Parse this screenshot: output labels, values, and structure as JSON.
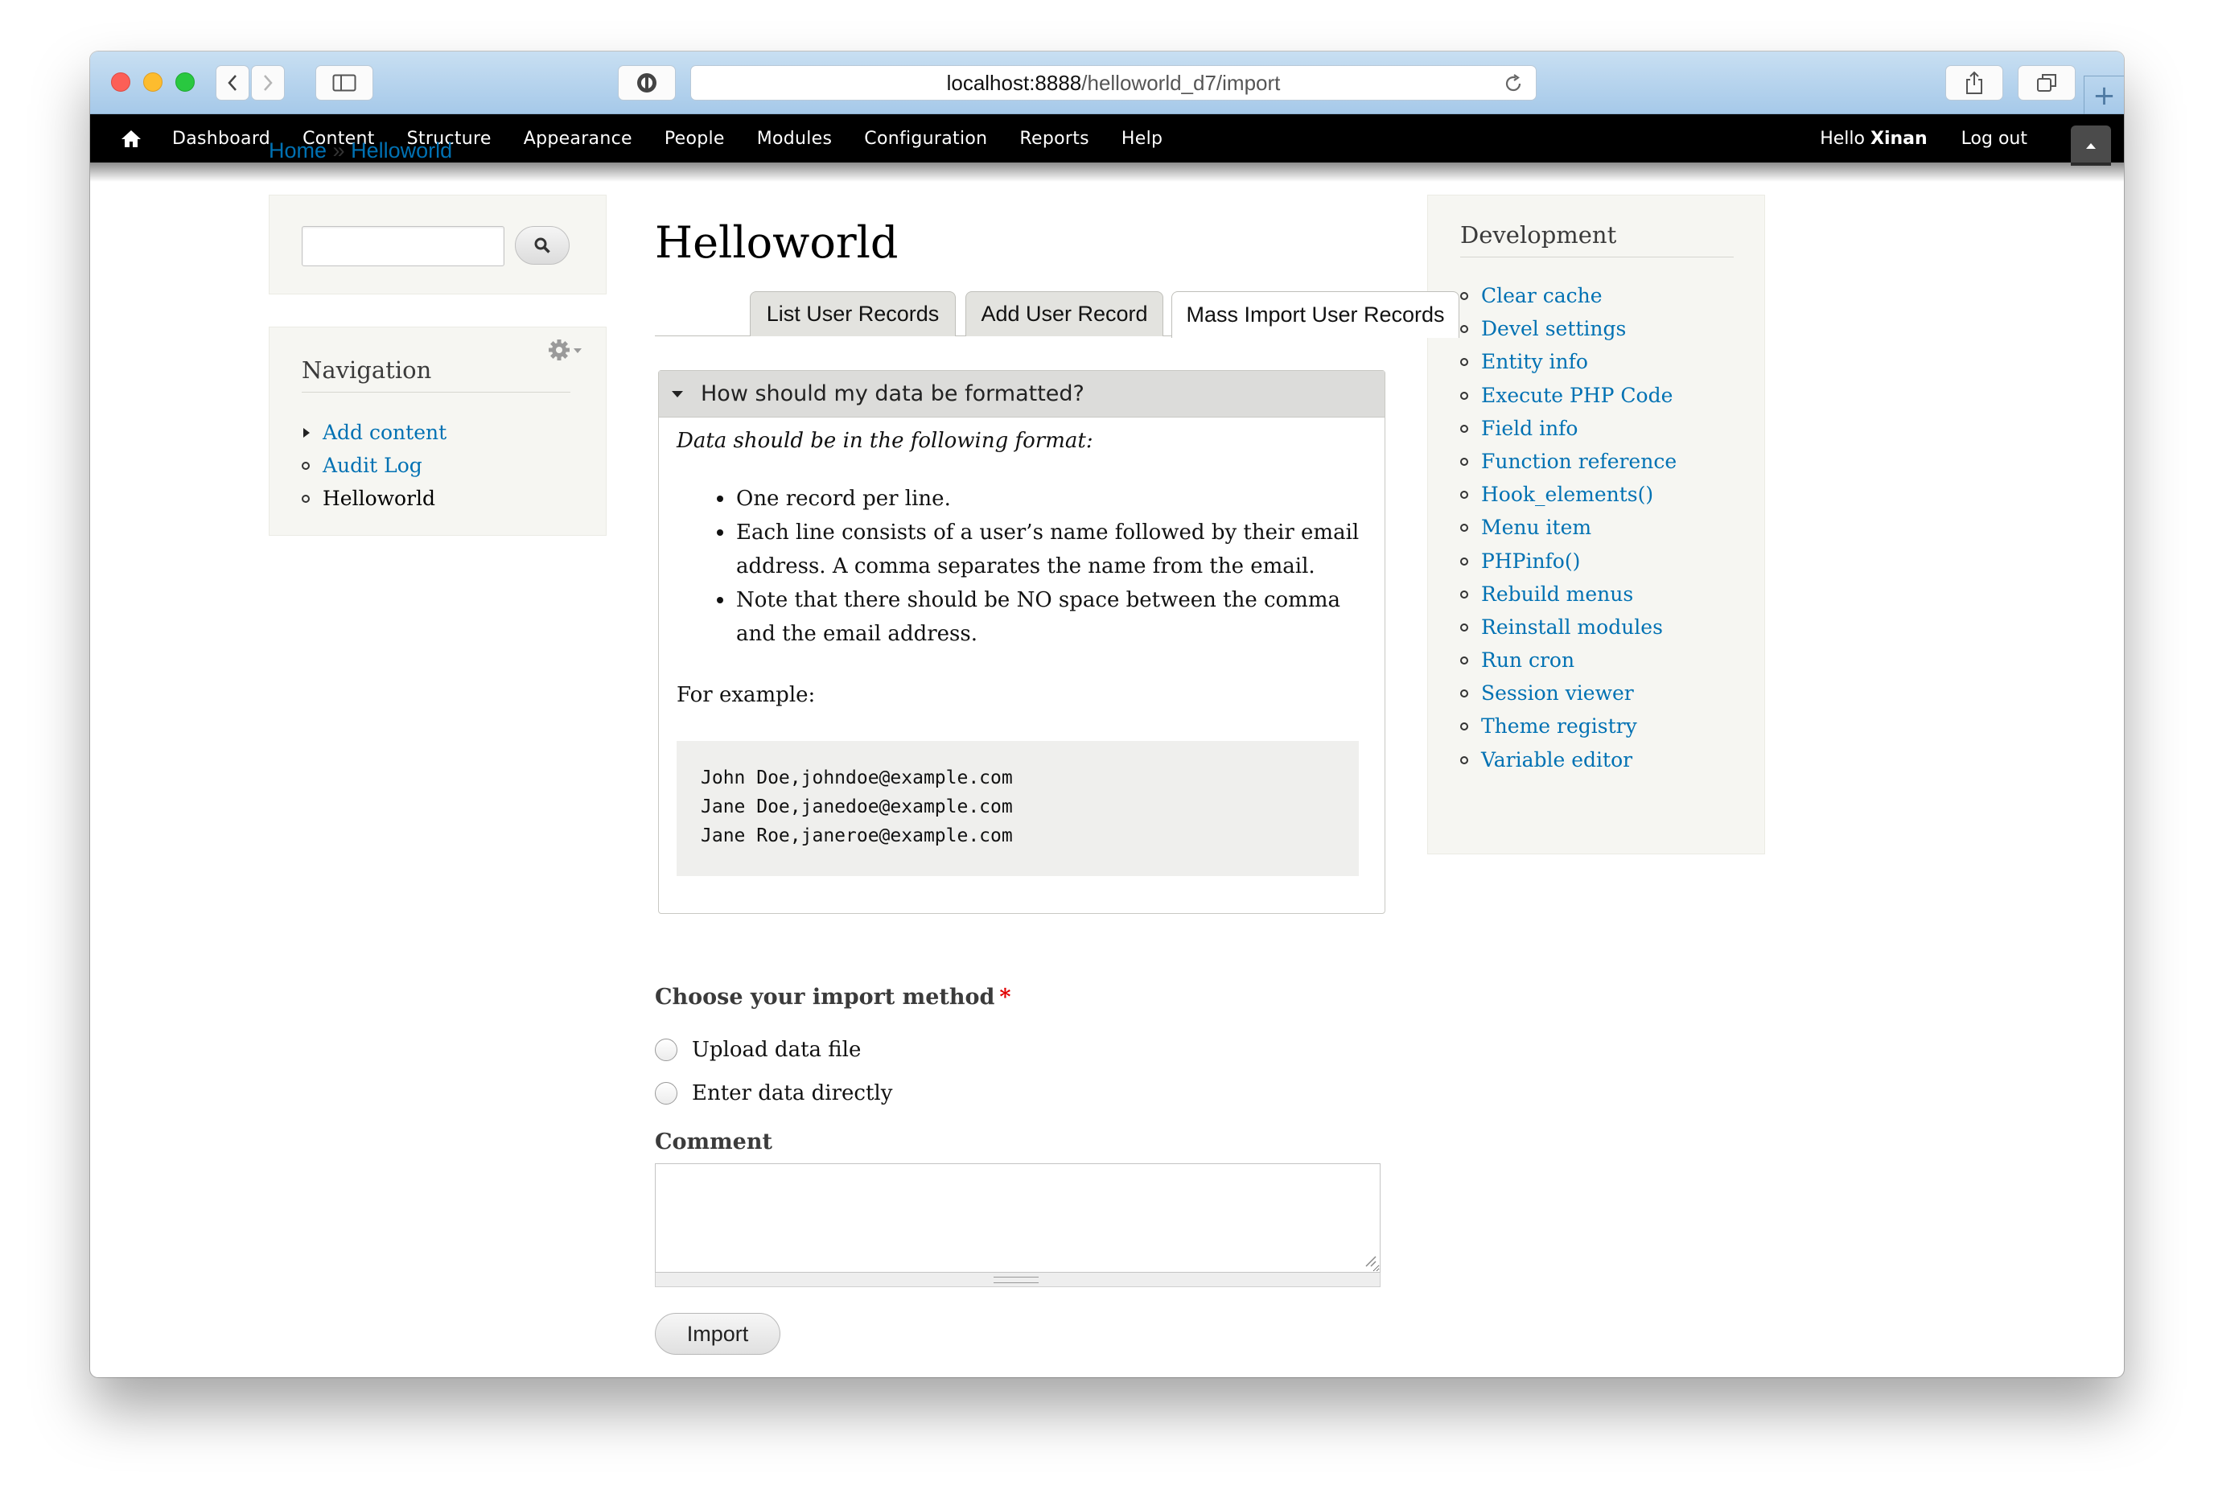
{
  "browser": {
    "url_host": "localhost:8888",
    "url_path": "/helloworld_d7/import"
  },
  "toolbar": {
    "menu": [
      "Dashboard",
      "Content",
      "Structure",
      "Appearance",
      "People",
      "Modules",
      "Configuration",
      "Reports",
      "Help"
    ],
    "hello_prefix": "Hello",
    "user_name": "Xinan",
    "logout": "Log out"
  },
  "breadcrumb": {
    "home": "Home",
    "separator": "»",
    "current": "Helloworld"
  },
  "search": {
    "placeholder": ""
  },
  "navigation": {
    "title": "Navigation",
    "items": [
      "Add content",
      "Audit Log",
      "Helloworld"
    ]
  },
  "development": {
    "title": "Development",
    "items": [
      "Clear cache",
      "Devel settings",
      "Entity info",
      "Execute PHP Code",
      "Field info",
      "Function reference",
      "Hook_elements()",
      "Menu item",
      "PHPinfo()",
      "Rebuild menus",
      "Reinstall modules",
      "Run cron",
      "Session viewer",
      "Theme registry",
      "Variable editor"
    ]
  },
  "main": {
    "title": "Helloworld",
    "tabs": [
      "List User Records",
      "Add User Record",
      "Mass Import User Records"
    ],
    "fieldset": {
      "legend": "How should my data be formatted?",
      "intro": "Data should be in the following format:",
      "rules": [
        "One record per line.",
        "Each line consists of a user’s name followed by their email address. A comma separates the name from the email.",
        "Note that there should be NO space between the comma and the email address."
      ],
      "example_label": "For example:",
      "example_lines": [
        "John Doe,johndoe@example.com",
        "Jane Doe,janedoe@example.com",
        "Jane Roe,janeroe@example.com"
      ]
    },
    "import_method": {
      "label": "Choose your import method",
      "required_mark": "*",
      "options": [
        "Upload data file",
        "Enter data directly"
      ]
    },
    "comment": {
      "label": "Comment",
      "value": ""
    },
    "submit_label": "Import"
  },
  "colors": {
    "link": "#0071b3",
    "toolbar": "#000000",
    "required": "#e00000"
  }
}
